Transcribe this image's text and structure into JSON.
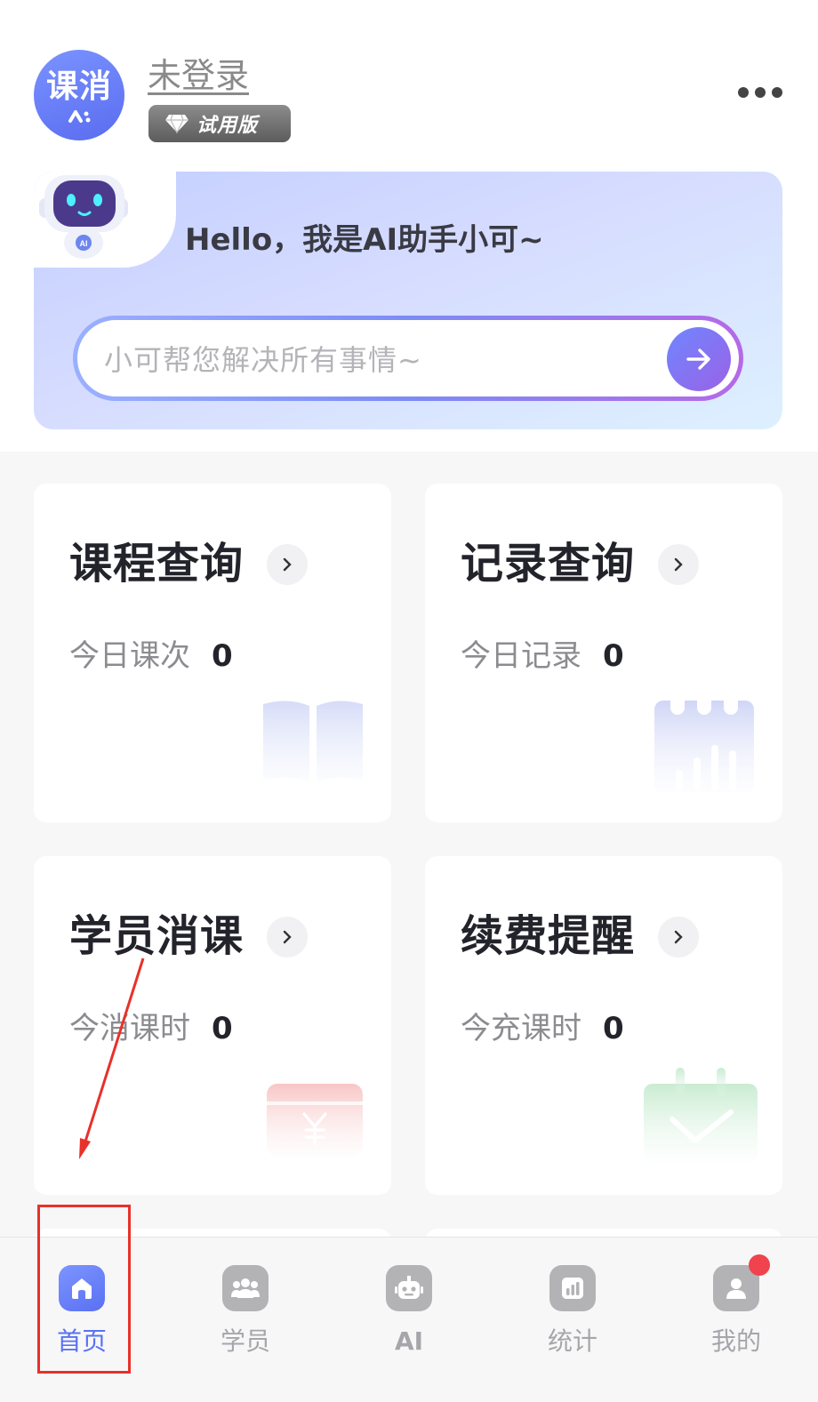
{
  "header": {
    "logo_text": "课消",
    "logo_mark": "^:",
    "login_status": "未登录",
    "version_badge": "试用版",
    "more_icon": "more-horizontal-icon"
  },
  "ai_assistant": {
    "greeting": "Hello，我是AI助手小可~",
    "input_placeholder": "小可帮您解决所有事情~",
    "send_icon": "arrow-right-icon"
  },
  "cards": [
    {
      "title": "课程查询",
      "stat_label": "今日课次",
      "stat_value": "0",
      "deco_icon": "book-icon"
    },
    {
      "title": "记录查询",
      "stat_label": "今日记录",
      "stat_value": "0",
      "deco_icon": "calendar-chart-icon"
    },
    {
      "title": "学员消课",
      "stat_label": "今消课时",
      "stat_value": "0",
      "deco_icon": "yuan-card-icon"
    },
    {
      "title": "续费提醒",
      "stat_label": "今充课时",
      "stat_value": "0",
      "deco_icon": "calendar-check-icon"
    }
  ],
  "tabbar": {
    "items": [
      {
        "label": "首页",
        "icon": "home-icon",
        "active": true
      },
      {
        "label": "学员",
        "icon": "users-icon",
        "active": false
      },
      {
        "label": "AI",
        "icon": "robot-icon",
        "active": false
      },
      {
        "label": "统计",
        "icon": "bar-chart-icon",
        "active": false
      },
      {
        "label": "我的",
        "icon": "user-icon",
        "active": false,
        "has_badge": true
      }
    ]
  },
  "colors": {
    "accent": "#5a72f2",
    "badge": "#f0434e",
    "annotation": "#e8312a"
  }
}
